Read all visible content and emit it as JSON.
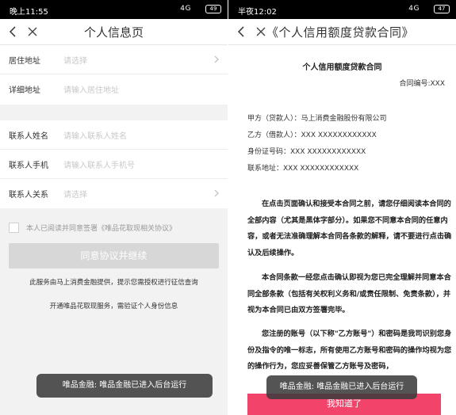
{
  "left": {
    "status": {
      "time": "晚上11:55",
      "signal": "4G",
      "battery": "49"
    },
    "nav": {
      "title": "个人信息页"
    },
    "address": [
      {
        "label": "居住地址",
        "value": "请选择"
      },
      {
        "label": "详细地址",
        "value": "请输入居住地址"
      }
    ],
    "contact": [
      {
        "label": "联系人姓名",
        "value": "请输入联系人姓名"
      },
      {
        "label": "联系人手机",
        "value": "请输入联系人手机号"
      },
      {
        "label": "联系人关系",
        "value": "请选择"
      }
    ],
    "agreement": "本人已阅读并同意签署《唯品花取现相关协议》",
    "continue_button": "同意协议并继续",
    "note1": "此服务由马上消费金融提供，提示您需授权进行征信查询",
    "note2": "开通唯品花取现服务，需验证个人身份信息",
    "toast": "唯品金融: 唯品金融已进入后台运行"
  },
  "right": {
    "status": {
      "time": "半夜12:02",
      "signal": "4G",
      "battery": "47"
    },
    "nav": {
      "title": "《个人信用额度贷款合同》"
    },
    "doc_title": "个人信用额度贷款合同",
    "contract_no": "合同编号:XXX",
    "parties": [
      "甲方（贷款人）：马上消费金融股份有限公司",
      "乙方（借款人）：XXX XXXXXXXXXXXX",
      "身份证号码：XXX XXXXXXXXXXXX",
      "联系地址：XXX XXXXXXXXXXXX"
    ],
    "para1": "在点击页面确认和接受本合同之前，请您仔细阅读本合同的全部内容（尤其是黑体字部分）。如果您不同意本合同的任意内容，或者无法准确理解本合同各条款的解释，请不要进行点击确认及后续操作。",
    "para2": "本合同条款一经您点击确认即视为您已完全理解并同意本合同全部条款（包括有关权利义务和/或责任限制、免责条款），并视为本合同已由双方签署完毕。",
    "para3": "您注册的账号（以下称\"乙方账号\"）和密码是我司识别您身份及指令的唯一标志，所有使用乙方账号和密码的操作均视为您的操作行为，您应妥善保管乙方账号及密码，",
    "toast": "唯品金融: 唯品金融已进入后台运行",
    "ok_button": "我知道了"
  },
  "colors": {
    "accent": "#f2436a",
    "disabled": "#d7d7d7"
  }
}
